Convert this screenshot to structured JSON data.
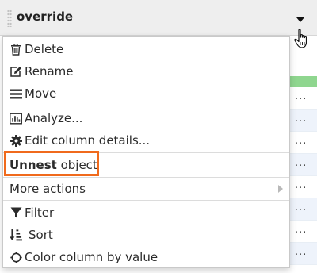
{
  "column": {
    "name": "override"
  },
  "menu": {
    "items": [
      {
        "id": "delete",
        "label": "Delete",
        "icon": "trash-icon"
      },
      {
        "id": "rename",
        "label": "Rename",
        "icon": "edit-icon"
      },
      {
        "id": "move",
        "label": "Move",
        "icon": "bars-icon"
      },
      {
        "id": "analyze",
        "label": "Analyze...",
        "icon": "bar-chart-icon"
      },
      {
        "id": "edit-details",
        "label": "Edit column details...",
        "icon": "gear-icon"
      },
      {
        "id": "unnest",
        "label_bold": "Unnest",
        "label_rest": " object"
      },
      {
        "id": "more-actions",
        "label": "More actions"
      },
      {
        "id": "filter",
        "label": "Filter",
        "icon": "filter-icon"
      },
      {
        "id": "sort",
        "label": "Sort",
        "icon": "sort-icon"
      },
      {
        "id": "color-by-value",
        "label": "Color column by value",
        "icon": "color-icon"
      }
    ]
  },
  "background": {
    "ellipsis": "..."
  },
  "colors": {
    "highlight": "#f06a1c",
    "header_bg": "#eeeeee",
    "green_strip": "#8fd68f"
  }
}
